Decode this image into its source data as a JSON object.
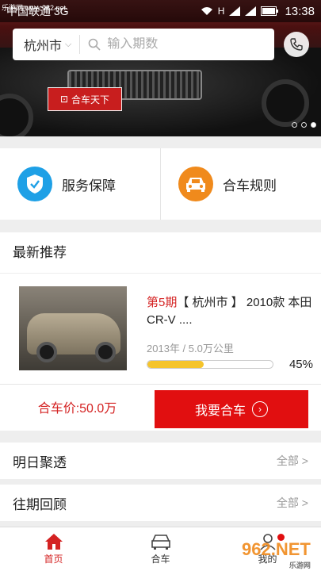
{
  "watermark": "乐游网 www.962.net",
  "statusbar": {
    "carrier": "中国联通 3G",
    "net": "H",
    "time": "13:38"
  },
  "banner": {
    "plate_text": "合车天下"
  },
  "search": {
    "city": "杭州市",
    "placeholder": "输入期数"
  },
  "services": [
    {
      "label": "服务保障",
      "icon": "shield-check-icon",
      "color": "#1ea0e6"
    },
    {
      "label": "合车规则",
      "icon": "car-icon",
      "color": "#f08a1c"
    }
  ],
  "latest": {
    "title": "最新推荐",
    "item": {
      "issue": "第5期",
      "title": "【 杭州市 】 2010款 本田CR-V ....",
      "meta": "2013年 / 5.0万公里",
      "progress": 0.45,
      "progress_text": "45%",
      "price": "合车价:50.0万",
      "buy_label": "我要合车"
    }
  },
  "rows": [
    {
      "label": "明日聚透",
      "more": "全部 >"
    },
    {
      "label": "往期回顾",
      "more": "全部 >"
    }
  ],
  "nav": [
    {
      "label": "首页",
      "icon": "home-icon",
      "active": true
    },
    {
      "label": "合车",
      "icon": "car-front-icon",
      "active": false
    },
    {
      "label": "我的",
      "icon": "user-icon",
      "active": false
    }
  ],
  "watermark2": {
    "brand": "962.NET",
    "sub": "乐游网"
  },
  "colors": {
    "accent": "#e10f10",
    "progress": "#f5c42c"
  }
}
